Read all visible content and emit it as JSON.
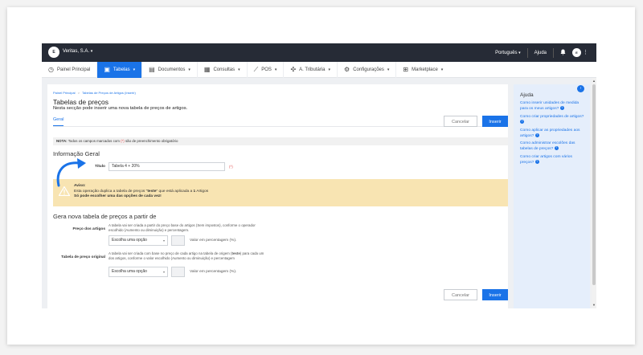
{
  "topbar": {
    "logo_text": "E",
    "company": "Veritas, S.A.",
    "language": "Português",
    "help": "Ajuda",
    "avatar_text": "E"
  },
  "nav": [
    {
      "label": "Painel Principal",
      "icon": "dashboard-icon",
      "active": false
    },
    {
      "label": "Tabelas",
      "icon": "tables-icon",
      "active": true
    },
    {
      "label": "Documentos",
      "icon": "documents-icon",
      "active": false
    },
    {
      "label": "Consultas",
      "icon": "chart-icon",
      "active": false
    },
    {
      "label": "POS",
      "icon": "pos-icon",
      "active": false
    },
    {
      "label": "A. Tributária",
      "icon": "tax-icon",
      "active": false
    },
    {
      "label": "Configurações",
      "icon": "gear-icon",
      "active": false
    },
    {
      "label": "Marketplace",
      "icon": "marketplace-icon",
      "active": false
    }
  ],
  "page": {
    "breadcrumb_home": "Painel Principal",
    "breadcrumb_sep": ">",
    "breadcrumb_current": "Tabelas de Preços de Artigos (Inserir)",
    "title": "Tabelas de preços",
    "subtitle": "Nesta secção pode inserir uma nova tabela de preços de artigos.",
    "tab": "Geral",
    "cancel": "Cancelar",
    "insert": "Inserir"
  },
  "note": {
    "prefix": "NOTA:",
    "text_before": " Todos os campos marcados com ",
    "required": "(*)",
    "text_after": " são de preenchimento obrigatório"
  },
  "info": {
    "heading": "Informação Geral",
    "title_label": "Título",
    "title_value": "Tabela 4 + 20%",
    "required_mark": "(*)"
  },
  "warning": {
    "heading": "Aviso:",
    "line1_a": "Esta operação duplica a tabela de preços \"",
    "line1_bold": "teste",
    "line1_b": "\" que está aplicada a ",
    "line1_count": "1",
    "line1_c": " Artigos",
    "line2": "Só pode escolher uma das opções de cada vez!"
  },
  "generate": {
    "heading": "Gera nova tabela de preços a partir de",
    "base_label": "Preço dos artigos",
    "base_desc": "A tabela vai ser criada a partir do preço base do artigos (Sem impostos), conforme o operador escolhido (Aumento ou diminuição) e percentagem.",
    "base_select": "Escolha uma opção",
    "base_unit": "Valor em percentagem (%).",
    "orig_label": "Tabela de preço original",
    "orig_desc_a": "A tabela vai ser criada com base no preço de cada artigo na tabela de origem (",
    "orig_desc_bold": "teste",
    "orig_desc_b": ") para cada um dos artigos, conforme o valor escolhido (Aumento ou diminuição) e percentagem",
    "orig_select": "Escolha uma opção",
    "orig_unit": "Valor em percentagem (%).",
    "cancel": "Cancelar",
    "insert": "Inserir"
  },
  "help": {
    "title": "Ajuda",
    "items": [
      "Como inserir unidades de medida para os meus artigos?",
      "Como criar propriedades de artigos?",
      "Como aplicar as propriedades aos artigos?",
      "Como administrar escolões das tabelas de preços?",
      "Como criar artigos com vários preços?"
    ]
  },
  "colors": {
    "primary": "#1a73e8",
    "topbar": "#262b36",
    "warning_bg": "#f8e4b2",
    "help_bg": "#e5eefb",
    "required": "#e55353"
  }
}
